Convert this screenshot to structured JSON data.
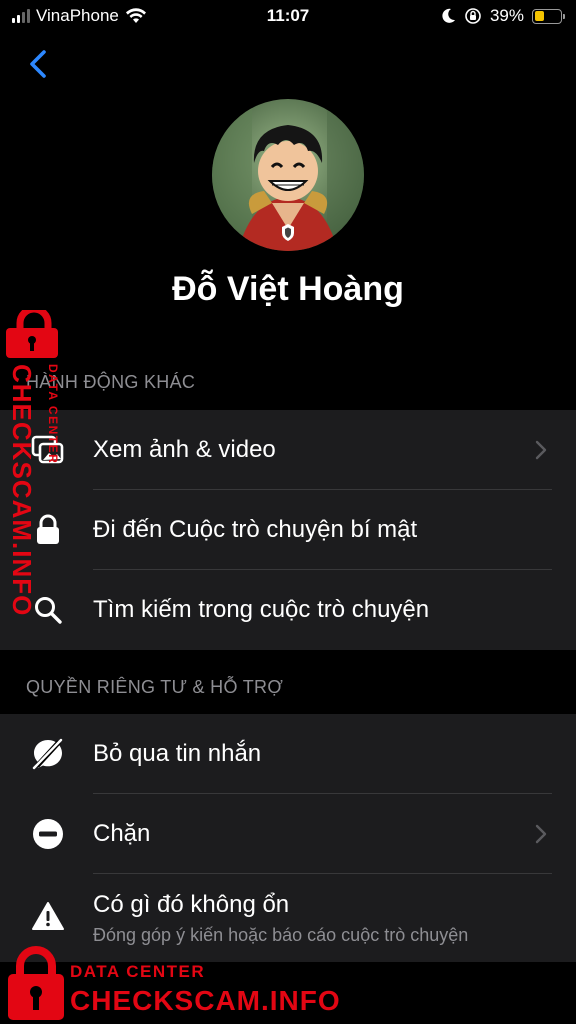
{
  "status_bar": {
    "carrier": "VinaPhone",
    "time": "11:07",
    "battery": "39%",
    "battery_level": 0.39
  },
  "nav": {
    "back_icon": "chevron-left-icon"
  },
  "profile": {
    "name": "Đỗ Việt Hoàng",
    "avatar_badge_icon": "shield-icon"
  },
  "sections": {
    "more_actions": {
      "title": "HÀNH ĐỘNG KHÁC",
      "items": [
        {
          "label": "Xem ảnh & video",
          "icon": "photos-icon",
          "chevron": true
        },
        {
          "label": "Đi đến Cuộc trò chuyện bí mật",
          "icon": "lock-icon",
          "chevron": false
        },
        {
          "label": "Tìm kiếm trong cuộc trò chuyện",
          "icon": "search-icon",
          "chevron": false
        }
      ]
    },
    "privacy": {
      "title": "QUYỀN RIÊNG TƯ & HỖ TRỢ",
      "items": [
        {
          "label": "Bỏ qua tin nhắn",
          "icon": "ignore-messages-icon",
          "chevron": false
        },
        {
          "label": "Chặn",
          "icon": "block-icon",
          "chevron": true
        },
        {
          "label": "Có gì đó không ổn",
          "sublabel": "Đóng góp ý kiến hoặc báo cáo cuộc trò chuyện",
          "icon": "warning-icon",
          "chevron": false
        }
      ]
    }
  },
  "watermark": {
    "line1": "DATA CENTER",
    "line2": "CHECKSCAM.INFO",
    "color": "#e30613"
  }
}
